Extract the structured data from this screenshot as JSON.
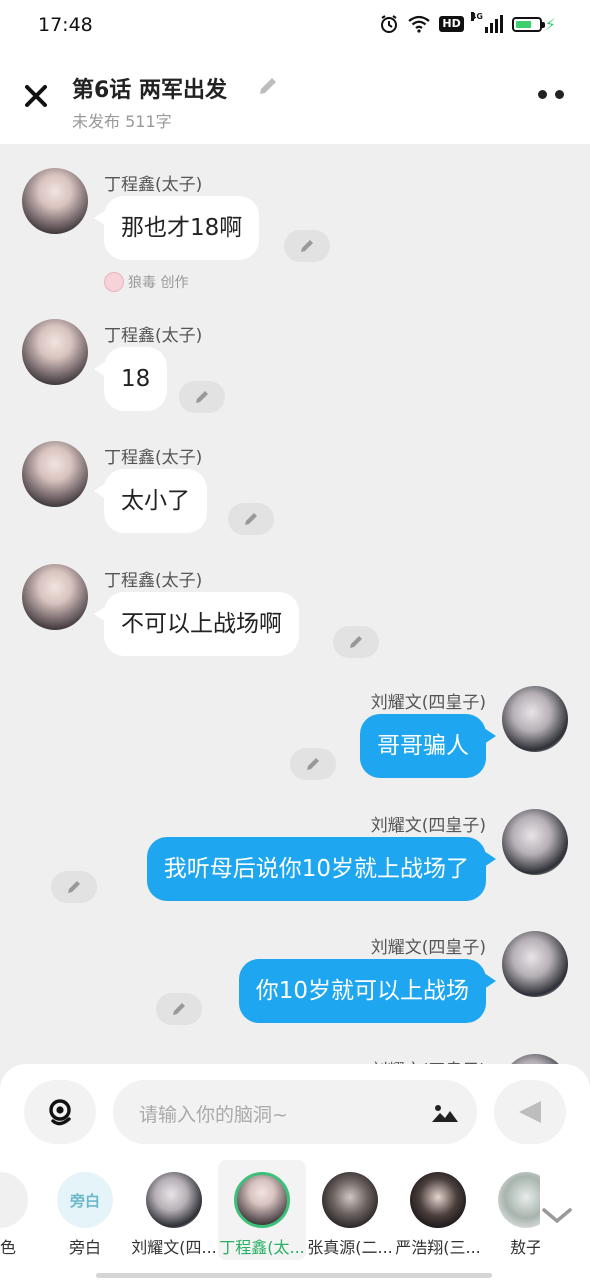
{
  "status_bar": {
    "time": "17:48",
    "network_label": "4G",
    "hd_label": "HD"
  },
  "header": {
    "title": "第6话  两军出发",
    "subtitle": "未发布 511字"
  },
  "messages": [
    {
      "side": "left",
      "name": "丁程鑫(太子)",
      "text": "那也才18啊",
      "creator": "狼毒 创作"
    },
    {
      "side": "left",
      "name": "丁程鑫(太子)",
      "text": "18"
    },
    {
      "side": "left",
      "name": "丁程鑫(太子)",
      "text": "太小了"
    },
    {
      "side": "left",
      "name": "丁程鑫(太子)",
      "text": "不可以上战场啊"
    },
    {
      "side": "right",
      "name": "刘耀文(四皇子)",
      "text": "哥哥骗人"
    },
    {
      "side": "right",
      "name": "刘耀文(四皇子)",
      "text": "我听母后说你10岁就上战场了"
    },
    {
      "side": "right",
      "name": "刘耀文(四皇子)",
      "text": "你10岁就可以上战场"
    },
    {
      "side": "right",
      "name": "刘耀文(四皇子)",
      "text": ""
    }
  ],
  "composer": {
    "placeholder": "请输入你的脑洞~"
  },
  "roles": [
    {
      "name": "角色",
      "avatar_text": ""
    },
    {
      "name": "旁白",
      "avatar_text": "旁白"
    },
    {
      "name": "刘耀文(四...",
      "avatar_text": ""
    },
    {
      "name": "丁程鑫(太...",
      "avatar_text": "",
      "active": true
    },
    {
      "name": "张真源(二...",
      "avatar_text": ""
    },
    {
      "name": "严浩翔(三...",
      "avatar_text": ""
    },
    {
      "name": "敖子",
      "avatar_text": ""
    }
  ],
  "colors": {
    "bubble_right": "#1ea6f0",
    "active_role": "#28b064",
    "background": "#efefef"
  }
}
